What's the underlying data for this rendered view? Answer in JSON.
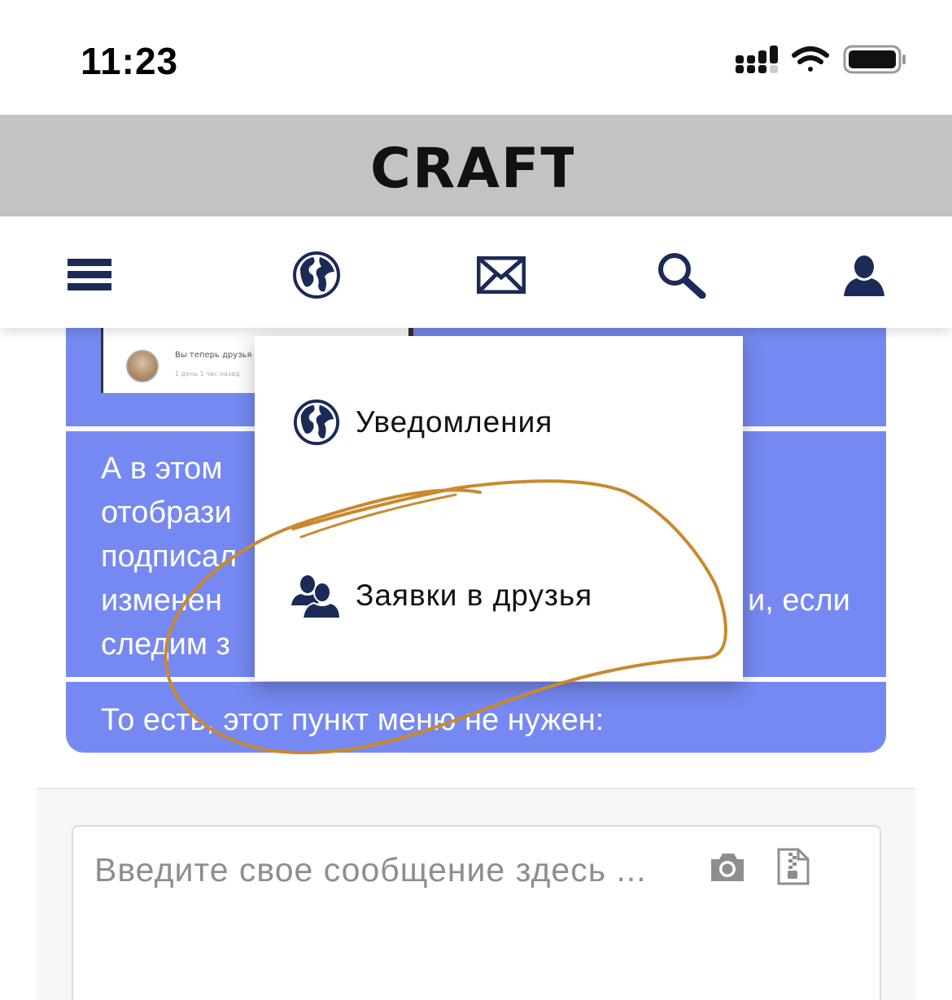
{
  "status_bar": {
    "time": "11:23",
    "icons": [
      "signal-icon",
      "wifi-icon",
      "battery-icon"
    ]
  },
  "header": {
    "logo_text": "CRAFT"
  },
  "nav": {
    "items": [
      {
        "name": "menu",
        "icon": "hamburger-menu-icon"
      },
      {
        "name": "notifications",
        "icon": "globe-icon"
      },
      {
        "name": "messages",
        "icon": "envelope-icon"
      },
      {
        "name": "search",
        "icon": "search-icon"
      },
      {
        "name": "profile",
        "icon": "user-icon"
      }
    ]
  },
  "dropdown": {
    "items": [
      {
        "label": "Уведомления",
        "icon": "globe-icon"
      },
      {
        "label": "Заявки в друзья",
        "icon": "users-icon"
      }
    ]
  },
  "message": {
    "preview_text_1": "Вы теперь друзья",
    "preview_text_2": "1 день 1 час назад",
    "paragraph": "А в этом отобрази подписал изменен следим з",
    "paragraph_right": "и, если",
    "footer_text": "То есть, этот пункт меню не нужен:"
  },
  "compose": {
    "placeholder": "Введите свое сообщение здесь ...",
    "icons": [
      "camera-icon",
      "file-zip-icon"
    ]
  },
  "colors": {
    "header_bg": "#c3c3c3",
    "bubble_bg": "#7689f2",
    "icon_navy": "#1b2a57",
    "annotation_stroke": "#c88a2e"
  }
}
